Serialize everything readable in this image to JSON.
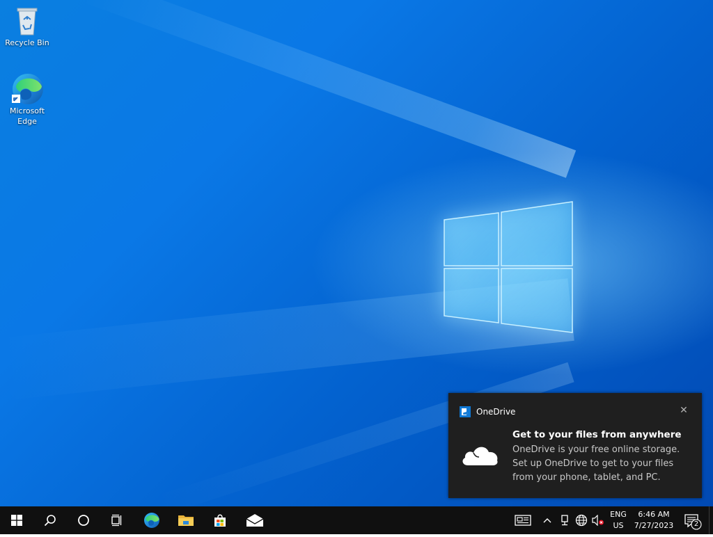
{
  "desktop": {
    "icons": [
      {
        "label": "Recycle Bin",
        "icon": "recycle-bin-icon"
      },
      {
        "label": "Microsoft Edge",
        "icon": "edge-icon"
      }
    ]
  },
  "toast": {
    "app_name": "OneDrive",
    "title": "Get to your files from anywhere",
    "body": "OneDrive is your free online storage. Set up OneDrive to get to your files from your phone, tablet, and PC.",
    "close_icon": "close-icon",
    "image_icon": "cloud-icon"
  },
  "taskbar": {
    "pinned": [
      {
        "name": "start",
        "icon": "windows-icon"
      },
      {
        "name": "search",
        "icon": "search-icon"
      },
      {
        "name": "cortana",
        "icon": "cortana-icon"
      },
      {
        "name": "task-view",
        "icon": "task-view-icon"
      },
      {
        "name": "edge",
        "icon": "edge-icon"
      },
      {
        "name": "file-explorer",
        "icon": "folder-icon"
      },
      {
        "name": "store",
        "icon": "store-icon"
      },
      {
        "name": "mail",
        "icon": "mail-icon"
      }
    ],
    "tray": {
      "language_line1": "ENG",
      "language_line2": "US",
      "time": "6:46 AM",
      "date": "7/27/2023",
      "notification_count": "2"
    }
  },
  "colors": {
    "taskbar_bg": "#101010",
    "toast_bg": "#1f1f1f",
    "accent": "#0f78d4"
  }
}
